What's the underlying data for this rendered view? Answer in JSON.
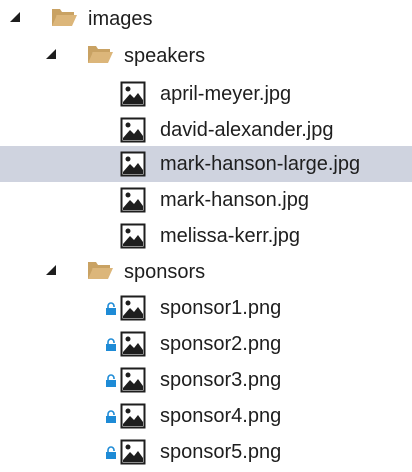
{
  "tree": {
    "root": {
      "label": "images",
      "icon": "folder-open-icon",
      "expanded": true,
      "children": [
        {
          "label": "speakers",
          "icon": "folder-open-icon",
          "expanded": true,
          "files": [
            {
              "label": "april-meyer.jpg",
              "icon": "image-file-icon",
              "locked": false,
              "selected": false
            },
            {
              "label": "david-alexander.jpg",
              "icon": "image-file-icon",
              "locked": false,
              "selected": false
            },
            {
              "label": "mark-hanson-large.jpg",
              "icon": "image-file-icon",
              "locked": false,
              "selected": true
            },
            {
              "label": "mark-hanson.jpg",
              "icon": "image-file-icon",
              "locked": false,
              "selected": false
            },
            {
              "label": "melissa-kerr.jpg",
              "icon": "image-file-icon",
              "locked": false,
              "selected": false
            }
          ]
        },
        {
          "label": "sponsors",
          "icon": "folder-open-icon",
          "expanded": true,
          "files": [
            {
              "label": "sponsor1.png",
              "icon": "image-file-icon",
              "locked": true,
              "selected": false
            },
            {
              "label": "sponsor2.png",
              "icon": "image-file-icon",
              "locked": true,
              "selected": false
            },
            {
              "label": "sponsor3.png",
              "icon": "image-file-icon",
              "locked": true,
              "selected": false
            },
            {
              "label": "sponsor4.png",
              "icon": "image-file-icon",
              "locked": true,
              "selected": false
            },
            {
              "label": "sponsor5.png",
              "icon": "image-file-icon",
              "locked": true,
              "selected": false
            }
          ]
        }
      ]
    }
  },
  "colors": {
    "selection": "#cfd3df",
    "folder": "#dcb67a",
    "lock": "#1e8bd6",
    "text": "#1e1e1e"
  }
}
